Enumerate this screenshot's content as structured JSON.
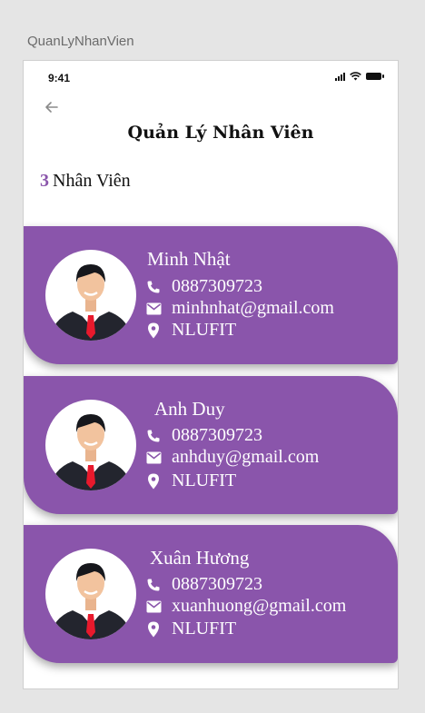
{
  "window": {
    "title": "QuanLyNhanVien"
  },
  "status_bar": {
    "time": "9:41"
  },
  "header": {
    "title": "Quản Lý Nhân Viên"
  },
  "summary": {
    "count": "3",
    "label": "Nhân Viên"
  },
  "employees": [
    {
      "name": "Minh Nhật",
      "phone": "0887309723",
      "email": "minhnhat@gmail.com",
      "location": "NLUFIT"
    },
    {
      "name": "Anh Duy",
      "phone": "0887309723",
      "email": "anhduy@gmail.com",
      "location": "NLUFIT"
    },
    {
      "name": "Xuân Hương",
      "phone": "0887309723",
      "email": "xuanhuong@gmail.com",
      "location": "NLUFIT"
    }
  ],
  "colors": {
    "card": "#8a55ab",
    "accent": "#8a55ab",
    "text_on_card": "#ffffff"
  },
  "icons": {
    "back": "arrow-left-icon",
    "phone": "phone-icon",
    "email": "mail-icon",
    "location": "location-pin-icon"
  }
}
